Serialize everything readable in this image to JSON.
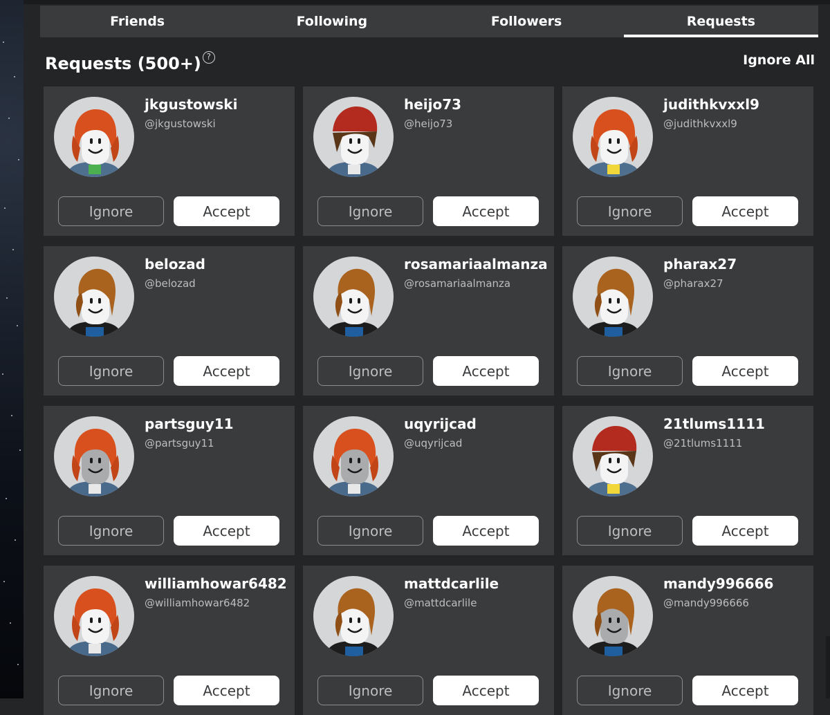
{
  "tabs": [
    {
      "label": "Friends",
      "active": false
    },
    {
      "label": "Following",
      "active": false
    },
    {
      "label": "Followers",
      "active": false
    },
    {
      "label": "Requests",
      "active": true
    }
  ],
  "heading": {
    "title": "Requests (500+)",
    "help_icon": "question-circle-icon"
  },
  "ignore_all_label": "Ignore All",
  "buttons": {
    "ignore_label": "Ignore",
    "accept_label": "Accept"
  },
  "requests": [
    {
      "name": "jkgustowski",
      "handle": "@jkgustowski",
      "hair": "red",
      "face": "white",
      "shirt": "denim-green"
    },
    {
      "name": "heijo73",
      "handle": "@heijo73",
      "hair": "brown-cap",
      "face": "white",
      "shirt": "denim"
    },
    {
      "name": "judithkvxxl9",
      "handle": "@judithkvxxl9",
      "hair": "red",
      "face": "white",
      "shirt": "denim-yellow"
    },
    {
      "name": "belozad",
      "handle": "@belozad",
      "hair": "bacon",
      "face": "white",
      "shirt": "black-blue"
    },
    {
      "name": "rosamariaalmanza",
      "handle": "@rosamariaalmanza",
      "hair": "bacon",
      "face": "white",
      "shirt": "black-blue"
    },
    {
      "name": "pharax27",
      "handle": "@pharax27",
      "hair": "bacon",
      "face": "white",
      "shirt": "black-blue"
    },
    {
      "name": "partsguy11",
      "handle": "@partsguy11",
      "hair": "red",
      "face": "grey",
      "shirt": "denim"
    },
    {
      "name": "uqyrijcad",
      "handle": "@uqyrijcad",
      "hair": "red",
      "face": "grey",
      "shirt": "denim"
    },
    {
      "name": "21tlums1111",
      "handle": "@21tlums1111",
      "hair": "brown-cap",
      "face": "white",
      "shirt": "denim-yellow"
    },
    {
      "name": "williamhowar6482",
      "handle": "@williamhowar6482",
      "hair": "red",
      "face": "white",
      "shirt": "denim"
    },
    {
      "name": "mattdcarlile",
      "handle": "@mattdcarlile",
      "hair": "bacon",
      "face": "white",
      "shirt": "black-blue"
    },
    {
      "name": "mandy996666",
      "handle": "@mandy996666",
      "hair": "bacon",
      "face": "grey",
      "shirt": "black-blue"
    }
  ]
}
